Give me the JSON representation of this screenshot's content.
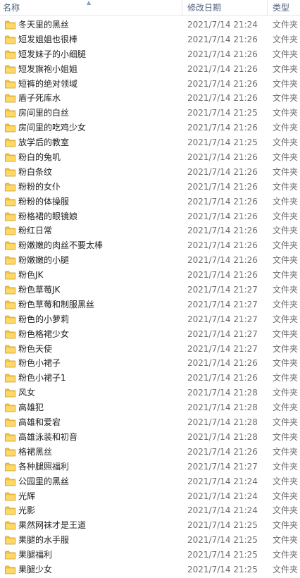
{
  "header": {
    "name": "名称",
    "modified": "修改日期",
    "type": "类型"
  },
  "rows": [
    {
      "name": "冬天里的黑丝",
      "date": "2021/7/14 21:24",
      "type": "文件夹"
    },
    {
      "name": "短发姐姐也很棒",
      "date": "2021/7/14 21:26",
      "type": "文件夹"
    },
    {
      "name": "短发妹子的小细腿",
      "date": "2021/7/14 21:26",
      "type": "文件夹"
    },
    {
      "name": "短发旗袍小姐姐",
      "date": "2021/7/14 21:26",
      "type": "文件夹"
    },
    {
      "name": "短裤的绝对领域",
      "date": "2021/7/14 21:26",
      "type": "文件夹"
    },
    {
      "name": "盾子死库水",
      "date": "2021/7/14 21:26",
      "type": "文件夹"
    },
    {
      "name": "房间里的白丝",
      "date": "2021/7/14 21:25",
      "type": "文件夹"
    },
    {
      "name": "房间里的吃鸡少女",
      "date": "2021/7/14 21:26",
      "type": "文件夹"
    },
    {
      "name": "放学后的教室",
      "date": "2021/7/14 21:25",
      "type": "文件夹"
    },
    {
      "name": "粉白的兔叽",
      "date": "2021/7/14 21:26",
      "type": "文件夹"
    },
    {
      "name": "粉白条纹",
      "date": "2021/7/14 21:26",
      "type": "文件夹"
    },
    {
      "name": "粉粉的女仆",
      "date": "2021/7/14 21:26",
      "type": "文件夹"
    },
    {
      "name": "粉粉的体操服",
      "date": "2021/7/14 21:26",
      "type": "文件夹"
    },
    {
      "name": "粉格裙的眼镜娘",
      "date": "2021/7/14 21:26",
      "type": "文件夹"
    },
    {
      "name": "粉红日常",
      "date": "2021/7/14 21:26",
      "type": "文件夹"
    },
    {
      "name": "粉嫩嫩的肉丝不要太棒",
      "date": "2021/7/14 21:26",
      "type": "文件夹"
    },
    {
      "name": "粉嫩嫩的小腿",
      "date": "2021/7/14 21:26",
      "type": "文件夹"
    },
    {
      "name": "粉色JK",
      "date": "2021/7/14 21:26",
      "type": "文件夹"
    },
    {
      "name": "粉色草莓JK",
      "date": "2021/7/14 21:27",
      "type": "文件夹"
    },
    {
      "name": "粉色草莓和制服黑丝",
      "date": "2021/7/14 21:27",
      "type": "文件夹"
    },
    {
      "name": "粉色的小萝莉",
      "date": "2021/7/14 21:27",
      "type": "文件夹"
    },
    {
      "name": "粉色格裙少女",
      "date": "2021/7/14 21:27",
      "type": "文件夹"
    },
    {
      "name": "粉色天使",
      "date": "2021/7/14 21:27",
      "type": "文件夹"
    },
    {
      "name": "粉色小裙子",
      "date": "2021/7/14 21:26",
      "type": "文件夹"
    },
    {
      "name": "粉色小裙子1",
      "date": "2021/7/14 21:26",
      "type": "文件夹"
    },
    {
      "name": "风女",
      "date": "2021/7/14 21:28",
      "type": "文件夹"
    },
    {
      "name": "高雄犯",
      "date": "2021/7/14 21:28",
      "type": "文件夹"
    },
    {
      "name": "高雄和爱宕",
      "date": "2021/7/14 21:28",
      "type": "文件夹"
    },
    {
      "name": "高雄泳装和初音",
      "date": "2021/7/14 21:28",
      "type": "文件夹"
    },
    {
      "name": "格裙黑丝",
      "date": "2021/7/14 21:26",
      "type": "文件夹"
    },
    {
      "name": "各种腿照福利",
      "date": "2021/7/14 21:27",
      "type": "文件夹"
    },
    {
      "name": "公园里的黑丝",
      "date": "2021/7/14 21:24",
      "type": "文件夹"
    },
    {
      "name": "光辉",
      "date": "2021/7/14 21:24",
      "type": "文件夹"
    },
    {
      "name": "光影",
      "date": "2021/7/14 21:24",
      "type": "文件夹"
    },
    {
      "name": "果然网袜才是王道",
      "date": "2021/7/14 21:25",
      "type": "文件夹"
    },
    {
      "name": "果腿的水手服",
      "date": "2021/7/14 21:25",
      "type": "文件夹"
    },
    {
      "name": "果腿福利",
      "date": "2021/7/14 21:25",
      "type": "文件夹"
    },
    {
      "name": "果腿少女",
      "date": "2021/7/14 21:25",
      "type": "文件夹"
    }
  ],
  "colors": {
    "folder_body": "#f0c54a",
    "folder_front": "#ffd966",
    "folder_edge": "#c9962b",
    "header_text": "#4c607a"
  },
  "icons": {
    "row_icon": "folder-icon",
    "sort_indicator": "sort-up-arrow-icon"
  }
}
